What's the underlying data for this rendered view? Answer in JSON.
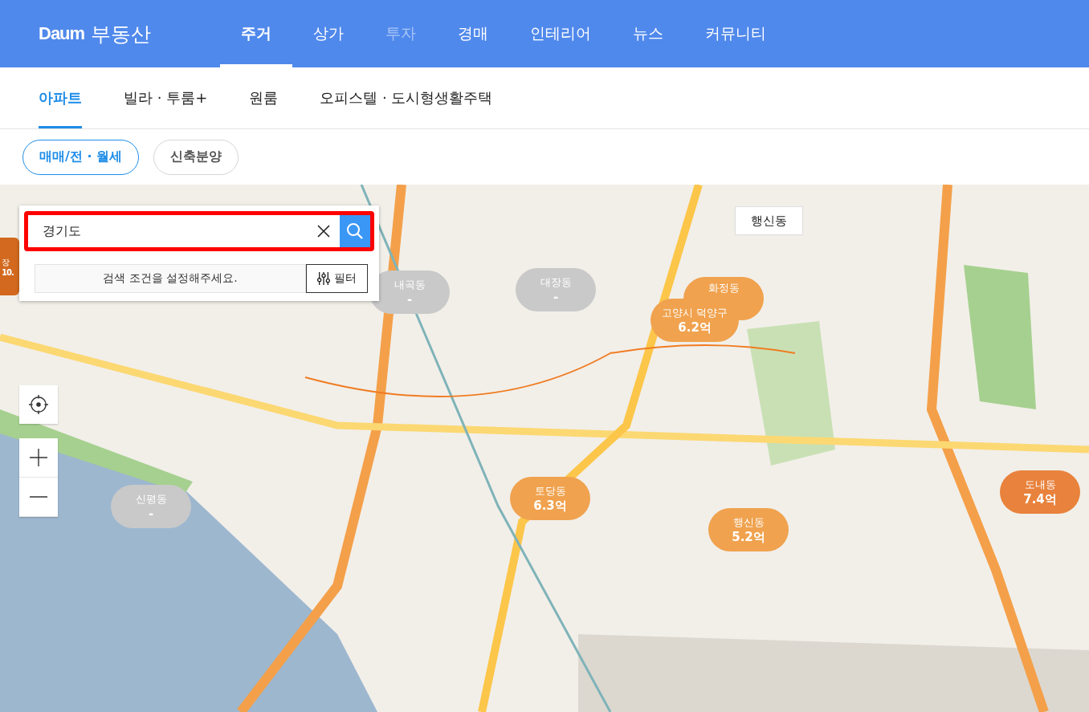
{
  "logo": {
    "brand": "Daum",
    "service": "부동산"
  },
  "main_tabs": [
    {
      "label": "주거",
      "selected": true,
      "disabled": false
    },
    {
      "label": "상가",
      "selected": false,
      "disabled": false
    },
    {
      "label": "투자",
      "selected": false,
      "disabled": true
    },
    {
      "label": "경매",
      "selected": false,
      "disabled": false
    },
    {
      "label": "인테리어",
      "selected": false,
      "disabled": false
    },
    {
      "label": "뉴스",
      "selected": false,
      "disabled": false
    },
    {
      "label": "커뮤니티",
      "selected": false,
      "disabled": false
    }
  ],
  "sub_tabs": [
    {
      "label": "아파트",
      "selected": true
    },
    {
      "label": "빌라 · 투룸+",
      "selected": false
    },
    {
      "label": "원룸",
      "selected": false
    },
    {
      "label": "오피스텔 · 도시형생활주택",
      "selected": false
    }
  ],
  "chips": [
    {
      "label": "매매/전 · 월세",
      "selected": true
    },
    {
      "label": "신축분양",
      "selected": false
    }
  ],
  "search": {
    "value": "경기도",
    "condition_hint": "검색 조건을 설정해주세요.",
    "filter_button": "필터"
  },
  "map": {
    "region_label": "행신동",
    "markers": [
      {
        "name": "장",
        "price": "10.",
        "color": "#d2691e"
      },
      {
        "name": "내곡동",
        "price": "-",
        "color": "#c9c9c9"
      },
      {
        "name": "대장동",
        "price": "-",
        "color": "#c9c9c9"
      },
      {
        "name": "화정동",
        "color": "#f0a24e"
      },
      {
        "name": "고양시 덕양구",
        "price": "6.2억",
        "color": "#f0a24e"
      },
      {
        "name": "토당동",
        "price": "6.3억",
        "color": "#f0a24e"
      },
      {
        "name": "행신동",
        "price": "5.2억",
        "color": "#f0a24e"
      },
      {
        "name": "도내동",
        "price": "7.4억",
        "color": "#e8823c"
      },
      {
        "name": "신평동",
        "price": "-",
        "color": "#c9c9c9"
      }
    ]
  }
}
